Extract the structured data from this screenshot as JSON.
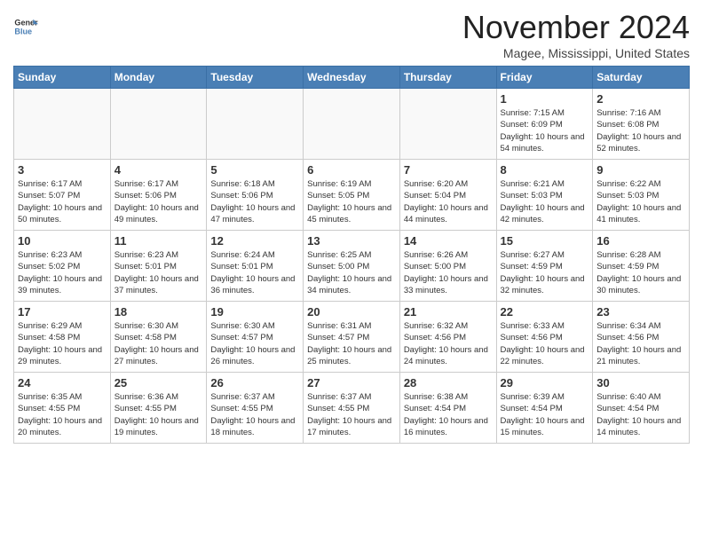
{
  "header": {
    "logo_line1": "General",
    "logo_line2": "Blue",
    "month": "November 2024",
    "location": "Magee, Mississippi, United States"
  },
  "weekdays": [
    "Sunday",
    "Monday",
    "Tuesday",
    "Wednesday",
    "Thursday",
    "Friday",
    "Saturday"
  ],
  "weeks": [
    [
      {
        "day": "",
        "text": ""
      },
      {
        "day": "",
        "text": ""
      },
      {
        "day": "",
        "text": ""
      },
      {
        "day": "",
        "text": ""
      },
      {
        "day": "",
        "text": ""
      },
      {
        "day": "1",
        "text": "Sunrise: 7:15 AM\nSunset: 6:09 PM\nDaylight: 10 hours and 54 minutes."
      },
      {
        "day": "2",
        "text": "Sunrise: 7:16 AM\nSunset: 6:08 PM\nDaylight: 10 hours and 52 minutes."
      }
    ],
    [
      {
        "day": "3",
        "text": "Sunrise: 6:17 AM\nSunset: 5:07 PM\nDaylight: 10 hours and 50 minutes."
      },
      {
        "day": "4",
        "text": "Sunrise: 6:17 AM\nSunset: 5:06 PM\nDaylight: 10 hours and 49 minutes."
      },
      {
        "day": "5",
        "text": "Sunrise: 6:18 AM\nSunset: 5:06 PM\nDaylight: 10 hours and 47 minutes."
      },
      {
        "day": "6",
        "text": "Sunrise: 6:19 AM\nSunset: 5:05 PM\nDaylight: 10 hours and 45 minutes."
      },
      {
        "day": "7",
        "text": "Sunrise: 6:20 AM\nSunset: 5:04 PM\nDaylight: 10 hours and 44 minutes."
      },
      {
        "day": "8",
        "text": "Sunrise: 6:21 AM\nSunset: 5:03 PM\nDaylight: 10 hours and 42 minutes."
      },
      {
        "day": "9",
        "text": "Sunrise: 6:22 AM\nSunset: 5:03 PM\nDaylight: 10 hours and 41 minutes."
      }
    ],
    [
      {
        "day": "10",
        "text": "Sunrise: 6:23 AM\nSunset: 5:02 PM\nDaylight: 10 hours and 39 minutes."
      },
      {
        "day": "11",
        "text": "Sunrise: 6:23 AM\nSunset: 5:01 PM\nDaylight: 10 hours and 37 minutes."
      },
      {
        "day": "12",
        "text": "Sunrise: 6:24 AM\nSunset: 5:01 PM\nDaylight: 10 hours and 36 minutes."
      },
      {
        "day": "13",
        "text": "Sunrise: 6:25 AM\nSunset: 5:00 PM\nDaylight: 10 hours and 34 minutes."
      },
      {
        "day": "14",
        "text": "Sunrise: 6:26 AM\nSunset: 5:00 PM\nDaylight: 10 hours and 33 minutes."
      },
      {
        "day": "15",
        "text": "Sunrise: 6:27 AM\nSunset: 4:59 PM\nDaylight: 10 hours and 32 minutes."
      },
      {
        "day": "16",
        "text": "Sunrise: 6:28 AM\nSunset: 4:59 PM\nDaylight: 10 hours and 30 minutes."
      }
    ],
    [
      {
        "day": "17",
        "text": "Sunrise: 6:29 AM\nSunset: 4:58 PM\nDaylight: 10 hours and 29 minutes."
      },
      {
        "day": "18",
        "text": "Sunrise: 6:30 AM\nSunset: 4:58 PM\nDaylight: 10 hours and 27 minutes."
      },
      {
        "day": "19",
        "text": "Sunrise: 6:30 AM\nSunset: 4:57 PM\nDaylight: 10 hours and 26 minutes."
      },
      {
        "day": "20",
        "text": "Sunrise: 6:31 AM\nSunset: 4:57 PM\nDaylight: 10 hours and 25 minutes."
      },
      {
        "day": "21",
        "text": "Sunrise: 6:32 AM\nSunset: 4:56 PM\nDaylight: 10 hours and 24 minutes."
      },
      {
        "day": "22",
        "text": "Sunrise: 6:33 AM\nSunset: 4:56 PM\nDaylight: 10 hours and 22 minutes."
      },
      {
        "day": "23",
        "text": "Sunrise: 6:34 AM\nSunset: 4:56 PM\nDaylight: 10 hours and 21 minutes."
      }
    ],
    [
      {
        "day": "24",
        "text": "Sunrise: 6:35 AM\nSunset: 4:55 PM\nDaylight: 10 hours and 20 minutes."
      },
      {
        "day": "25",
        "text": "Sunrise: 6:36 AM\nSunset: 4:55 PM\nDaylight: 10 hours and 19 minutes."
      },
      {
        "day": "26",
        "text": "Sunrise: 6:37 AM\nSunset: 4:55 PM\nDaylight: 10 hours and 18 minutes."
      },
      {
        "day": "27",
        "text": "Sunrise: 6:37 AM\nSunset: 4:55 PM\nDaylight: 10 hours and 17 minutes."
      },
      {
        "day": "28",
        "text": "Sunrise: 6:38 AM\nSunset: 4:54 PM\nDaylight: 10 hours and 16 minutes."
      },
      {
        "day": "29",
        "text": "Sunrise: 6:39 AM\nSunset: 4:54 PM\nDaylight: 10 hours and 15 minutes."
      },
      {
        "day": "30",
        "text": "Sunrise: 6:40 AM\nSunset: 4:54 PM\nDaylight: 10 hours and 14 minutes."
      }
    ]
  ]
}
